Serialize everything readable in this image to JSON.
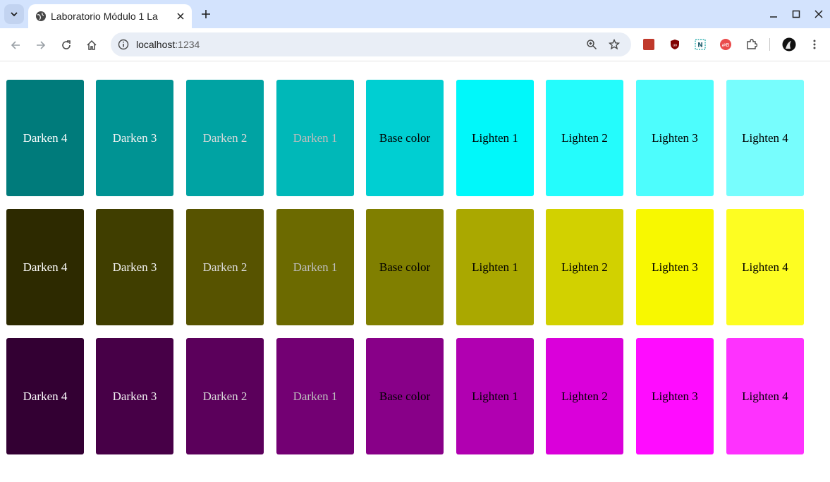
{
  "browser": {
    "tab_title": "Laboratorio Módulo 1 La",
    "url_host": "localhost",
    "url_port": ":1234"
  },
  "palettes": [
    {
      "name": "cyan",
      "swatches": [
        {
          "label": "Darken 4",
          "bg": "#007b7b",
          "fg": "#ffffff"
        },
        {
          "label": "Darken 3",
          "bg": "#009393",
          "fg": "#f2f2f2"
        },
        {
          "label": "Darken 2",
          "bg": "#00a3a3",
          "fg": "#d9d9d9"
        },
        {
          "label": "Darken 1",
          "bg": "#00b8b8",
          "fg": "#bdbdbd"
        },
        {
          "label": "Base color",
          "bg": "#00cfd2",
          "fg": "#000000"
        },
        {
          "label": "Lighten 1",
          "bg": "#00f8fa",
          "fg": "#000000"
        },
        {
          "label": "Lighten 2",
          "bg": "#24fcfc",
          "fg": "#000000"
        },
        {
          "label": "Lighten 3",
          "bg": "#4dfdfd",
          "fg": "#000000"
        },
        {
          "label": "Lighten 4",
          "bg": "#77fdfd",
          "fg": "#000000"
        }
      ]
    },
    {
      "name": "olive",
      "swatches": [
        {
          "label": "Darken 4",
          "bg": "#2d2a00",
          "fg": "#ffffff"
        },
        {
          "label": "Darken 3",
          "bg": "#403e00",
          "fg": "#f2f2f2"
        },
        {
          "label": "Darken 2",
          "bg": "#575300",
          "fg": "#d9d9d9"
        },
        {
          "label": "Darken 1",
          "bg": "#6c6a00",
          "fg": "#bdbdbd"
        },
        {
          "label": "Base color",
          "bg": "#807f00",
          "fg": "#000000"
        },
        {
          "label": "Lighten 1",
          "bg": "#aaa800",
          "fg": "#000000"
        },
        {
          "label": "Lighten 2",
          "bg": "#d2d100",
          "fg": "#000000"
        },
        {
          "label": "Lighten 3",
          "bg": "#f8f800",
          "fg": "#000000"
        },
        {
          "label": "Lighten 4",
          "bg": "#fdfd22",
          "fg": "#000000"
        }
      ]
    },
    {
      "name": "purple",
      "swatches": [
        {
          "label": "Darken 4",
          "bg": "#330033",
          "fg": "#ffffff"
        },
        {
          "label": "Darken 3",
          "bg": "#470047",
          "fg": "#f2f2f2"
        },
        {
          "label": "Darken 2",
          "bg": "#5b005b",
          "fg": "#d9d9d9"
        },
        {
          "label": "Darken 1",
          "bg": "#730073",
          "fg": "#bdbdbd"
        },
        {
          "label": "Base color",
          "bg": "#880088",
          "fg": "#000000"
        },
        {
          "label": "Lighten 1",
          "bg": "#b100b1",
          "fg": "#000000"
        },
        {
          "label": "Lighten 2",
          "bg": "#da00da",
          "fg": "#000000"
        },
        {
          "label": "Lighten 3",
          "bg": "#ff0cff",
          "fg": "#000000"
        },
        {
          "label": "Lighten 4",
          "bg": "#fe32fe",
          "fg": "#000000"
        }
      ]
    }
  ]
}
